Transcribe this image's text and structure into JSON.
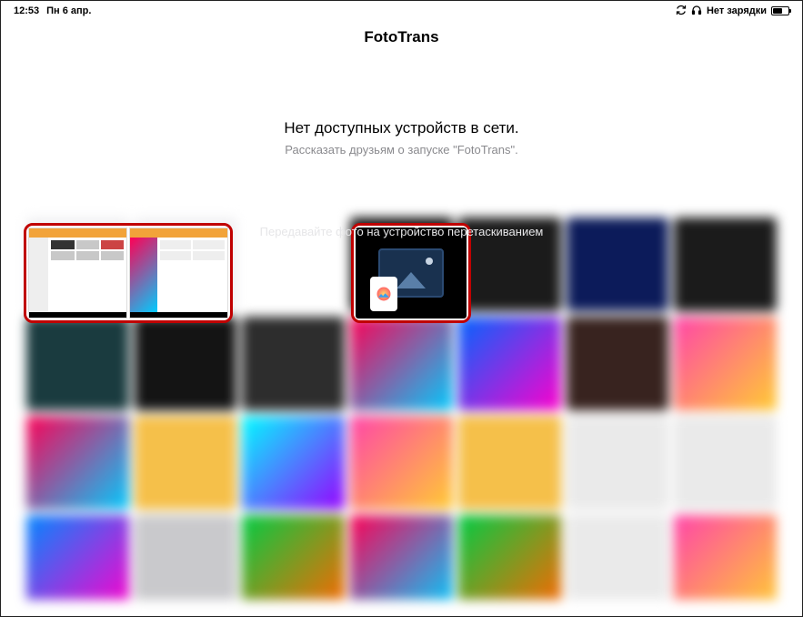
{
  "statusbar": {
    "time": "12:53",
    "date": "Пн 6 апр.",
    "sync_icon": "sync-icon",
    "headphones_icon": "headphones-icon",
    "battery_text": "Нет зарядки",
    "battery_icon": "battery-icon"
  },
  "app": {
    "title": "FotoTrans"
  },
  "messages": {
    "primary": "Нет доступных устройств в сети.",
    "secondary": "Рассказать друзьям о запуске  \"FotoTrans\".",
    "hint": "Передавайте фото на устройство перетаскиванием"
  },
  "grid": {
    "colors": [
      "#f0f0f2",
      "#f0f0f2",
      "#ffffff",
      "#111111",
      "#1b1b1b",
      "#0c1b5a",
      "#1b1b1b",
      "#1a3b3f",
      "#141414",
      "#2d2d2d",
      "linear-gradient(135deg,#f05,#0cf)",
      "linear-gradient(135deg,#06f,#f0c)",
      "#38231f",
      "linear-gradient(135deg,#f4a,#fc3)",
      "linear-gradient(135deg,#f05,#0cf)",
      "#f5c04a",
      "linear-gradient(135deg,#0ff,#90f)",
      "linear-gradient(135deg,#f4a,#fc3)",
      "#f5c04a",
      "#eaeaea",
      "#eaeaea",
      "linear-gradient(135deg,#08f,#f0c)",
      "#c9c9cc",
      "linear-gradient(135deg,#0c4,#f60)",
      "linear-gradient(135deg,#f05,#0cf)",
      "linear-gradient(135deg,#0c4,#f60)",
      "#eaeaea",
      "linear-gradient(135deg,#f4a,#fc3)"
    ]
  }
}
